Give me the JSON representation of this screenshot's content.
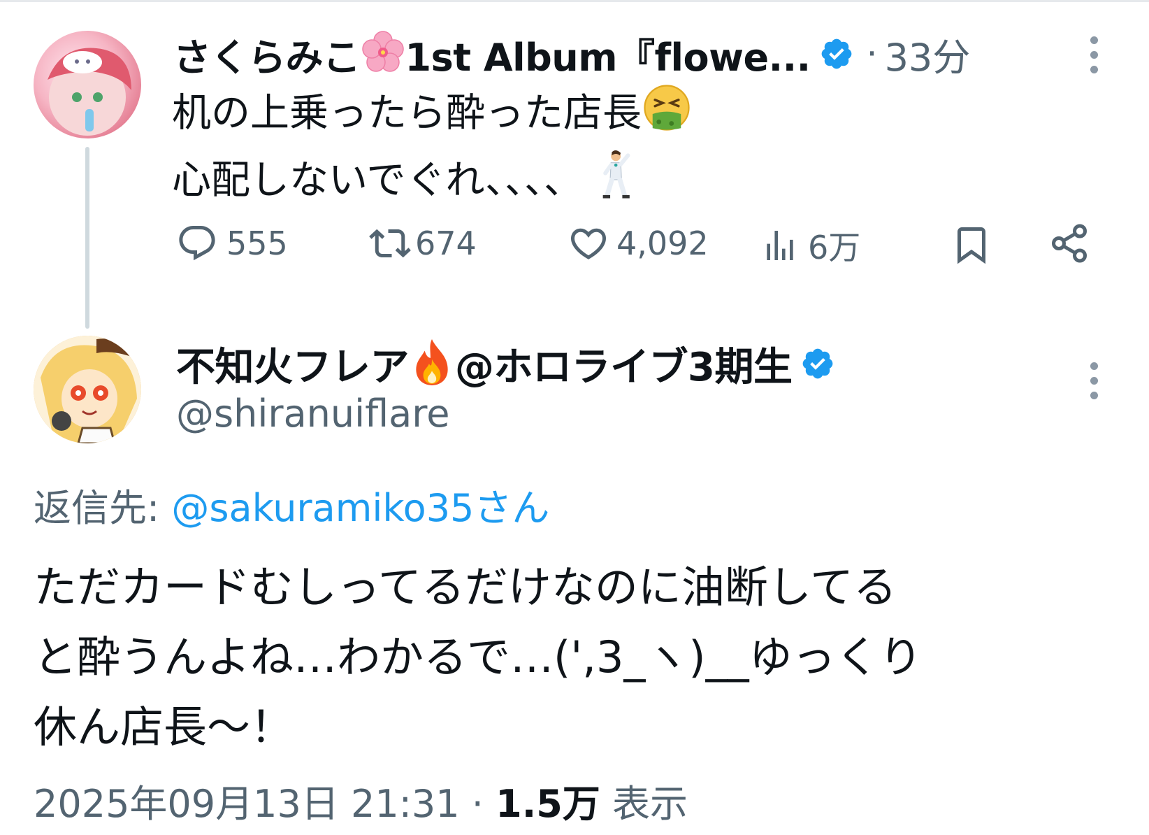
{
  "parent_tweet": {
    "display_name": "さくらみこ",
    "display_name_suffix": "1st Album『flowe...",
    "time_sep": "·",
    "time": "33分",
    "text_line1": "机の上乗ったら酔った店長",
    "text_line2": "心配しないでぐれ、、、、",
    "stats": {
      "replies": "555",
      "retweets": "674",
      "likes": "4,092",
      "views": "6万"
    }
  },
  "reply_tweet": {
    "display_name": "不知火フレア",
    "display_name_suffix": "@ホロライブ3期生",
    "handle": "@shiranuiflare",
    "reply_to_label": "返信先: ",
    "reply_to_mention": "@sakuramiko35さん",
    "text": "ただカードむしってるだけなのに油断してる\nと酔うんよね…わかるで…(',3_ヽ)__ゆっくり\n休ん店長〜！",
    "timestamp": "2025年09月13日 21:31",
    "meta_sep": " · ",
    "views_count": "1.5万",
    "views_label": " 表示"
  },
  "colors": {
    "text": "#0f1419",
    "muted": "#536471",
    "link": "#1d9bf0",
    "verified": "#1d9bf0"
  },
  "icons": [
    "verified-badge-icon",
    "more-icon",
    "reply-icon",
    "retweet-icon",
    "like-icon",
    "views-icon",
    "bookmark-icon",
    "share-icon",
    "cherry-blossom-icon",
    "nauseated-face-icon",
    "dancing-man-icon",
    "fire-icon"
  ]
}
